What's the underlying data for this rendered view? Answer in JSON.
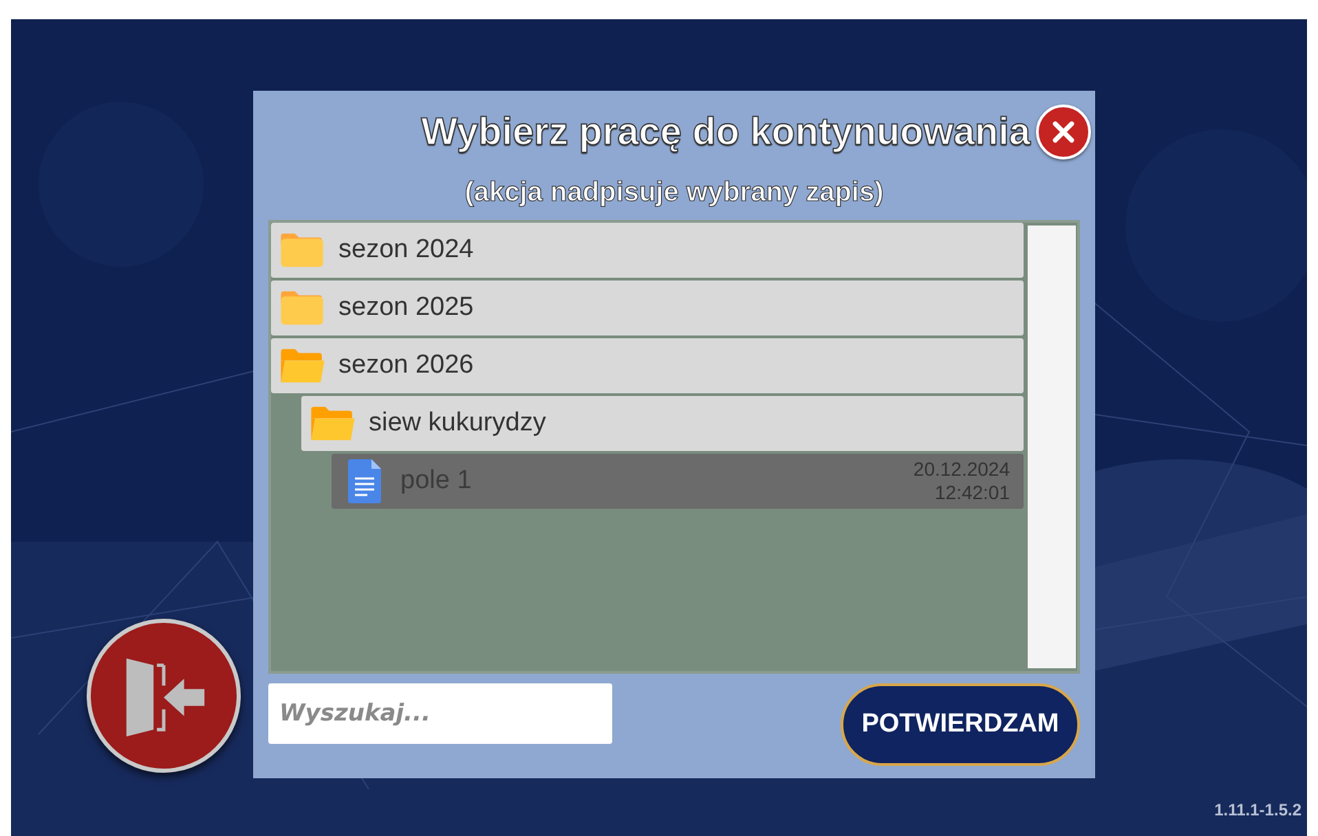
{
  "dialog": {
    "title": "Wybierz pracę do kontynuowania",
    "subtitle": "(akcja nadpisuje wybrany zapis)"
  },
  "tree": [
    {
      "kind": "folder",
      "name": "sezon 2024",
      "expanded": false,
      "selected": false
    },
    {
      "kind": "folder",
      "name": "sezon 2025",
      "expanded": false,
      "selected": false
    },
    {
      "kind": "folder",
      "name": "sezon 2026",
      "expanded": true,
      "selected": false,
      "children": [
        {
          "kind": "folder",
          "name": "siew kukurydzy",
          "expanded": true,
          "selected": false,
          "children": [
            {
              "kind": "file",
              "name": "pole 1",
              "date": "20.12.2024",
              "time": "12:42:01",
              "selected": true
            }
          ]
        }
      ]
    }
  ],
  "search": {
    "placeholder": "Wyszukaj..."
  },
  "confirm_button": "POTWIERDZAM",
  "version": "1.11.1-1.5.2"
}
